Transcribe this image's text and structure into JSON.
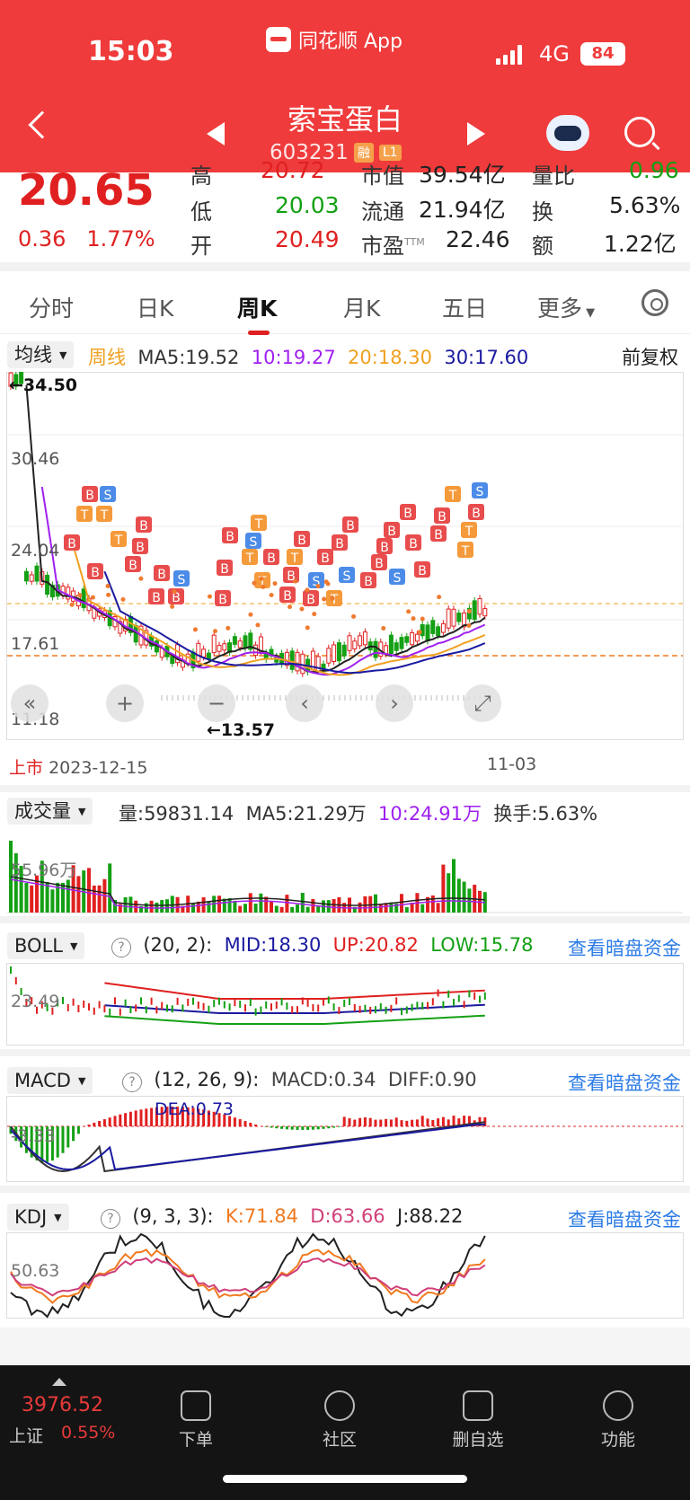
{
  "status": {
    "time": "15:03",
    "network": "4G",
    "battery": "84",
    "app": "同花顺 App"
  },
  "header": {
    "stock_name": "索宝蛋白",
    "stock_code": "603231",
    "tag1": "融",
    "tag2": "L1"
  },
  "quote": {
    "price": "20.65",
    "change": "0.36",
    "change_pct": "1.77%",
    "row0": {
      "l1": "高",
      "v1": "20.72",
      "l2": "市值",
      "v2": "39.54亿",
      "l3": "量比",
      "v3": "0.96"
    },
    "row1": {
      "l1": "低",
      "v1": "20.03",
      "l2": "流通",
      "v2": "21.94亿",
      "l3": "换",
      "v3": "5.63%"
    },
    "row2": {
      "l1": "开",
      "v1": "20.49",
      "l2": "市盈",
      "v2": "22.46",
      "l2sup": "TTM",
      "l3": "额",
      "v3": "1.22亿"
    }
  },
  "tabs": [
    "分时",
    "日K",
    "周K",
    "月K",
    "五日",
    "更多"
  ],
  "kline": {
    "dropdown": "均线",
    "period": "周线",
    "ma5": "MA5:19.52",
    "ma10": "10:19.27",
    "ma20": "20:18.30",
    "ma30": "30:17.60",
    "adjust": "前复权",
    "high_label": "←34.50",
    "low_label": "←13.57",
    "y_ticks": [
      "30.46",
      "24.04",
      "17.61",
      "11.18"
    ],
    "ipo_label": "上市",
    "start_date": "2023-12-15",
    "end_date": "11-03",
    "colors": {
      "ma5": "#222222",
      "ma10": "#a020f0",
      "ma20": "#f0a020",
      "ma30": "#1a1aa0",
      "up": "#e02020",
      "down": "#14a014"
    }
  },
  "volume": {
    "dropdown": "成交量",
    "vol": "量:59831.14",
    "ma5": "MA5:21.29万",
    "ma10": "10:24.91万",
    "turnover": "换手:5.63%",
    "axis": "55.96万"
  },
  "boll": {
    "dropdown": "BOLL",
    "params": "(20, 2):",
    "mid": "MID:18.30",
    "up": "UP:20.82",
    "low": "LOW:15.78",
    "link": "查看暗盘资金",
    "axis": "23.49"
  },
  "macd": {
    "dropdown": "MACD",
    "params": "(12, 26, 9):",
    "macd": "MACD:0.34",
    "diff": "DIFF:0.90",
    "dea": "DEA:0.73",
    "link": "查看暗盘资金",
    "axis": "-3.33"
  },
  "kdj": {
    "dropdown": "KDJ",
    "params": "(9, 3, 3):",
    "k": "K:71.84",
    "d": "D:63.66",
    "j": "J:88.22",
    "link": "查看暗盘资金",
    "axis": "50.63"
  },
  "index": {
    "value": "3976.52",
    "name": "上证",
    "pct": "0.55%"
  },
  "bottom_nav": [
    "下单",
    "社区",
    "删自选",
    "功能"
  ]
}
